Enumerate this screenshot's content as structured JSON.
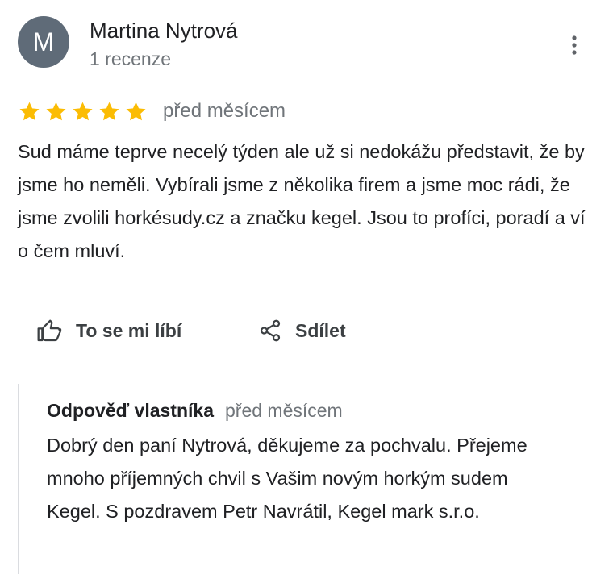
{
  "review": {
    "author": {
      "initial": "M",
      "name": "Martina Nytrová",
      "meta": "1 recenze",
      "avatar_color": "#5f6b78"
    },
    "rating": 5,
    "rating_max": 5,
    "star_color": "#fbbc04",
    "date": "před měsícem",
    "text": "Sud máme teprve necelý týden ale už si nedokážu představit, že by jsme ho neměli. Vybírali jsme z několika firem a jsme moc rádi, že jsme zvolili horkésudy.cz a značku kegel. Jsou to profíci, poradí  a ví o čem mluví.",
    "actions": {
      "like_label": "To se mi líbí",
      "like_icon": "thumb-up-icon",
      "share_label": "Sdílet",
      "share_icon": "share-icon"
    },
    "more_icon": "more-vert-icon"
  },
  "owner_reply": {
    "label": "Odpověď vlastníka",
    "date": "před měsícem",
    "text": "Dobrý den paní Nytrová, děkujeme za pochvalu. Přejeme mnoho příjemných chvil s Vašim novým horkým sudem Kegel. S pozdravem Petr Navrátil, Kegel mark s.r.o."
  }
}
